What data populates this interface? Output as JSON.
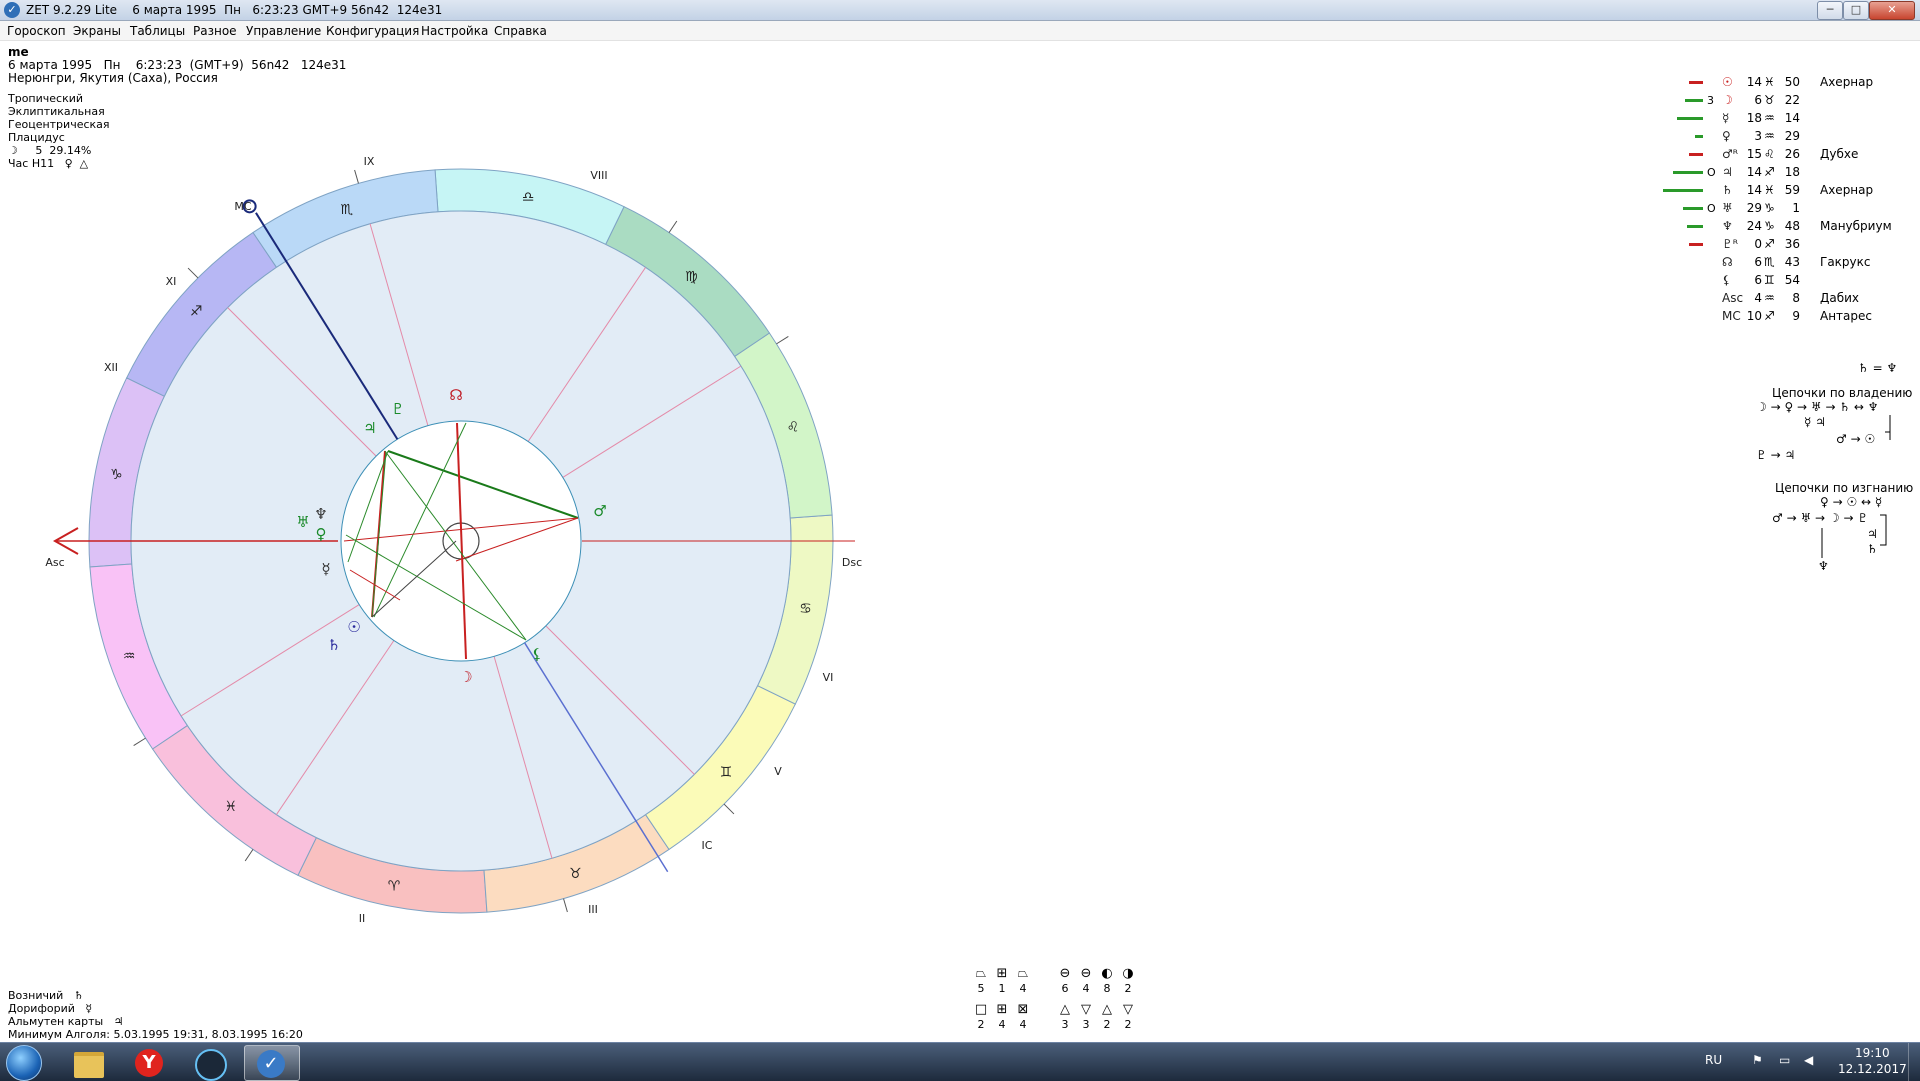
{
  "window": {
    "title": "ZET 9.2.29 Lite    6 марта 1995  Пн   6:23:23 GMT+9 56n42  124e31",
    "buttons": {
      "minimize": "─",
      "maximize": "□",
      "close": "✕"
    }
  },
  "menu": [
    "Гороскоп",
    "Экраны",
    "Таблицы",
    "Разное",
    "Управление",
    "Конфигурация",
    "Настройка",
    "Справка"
  ],
  "chart_info": {
    "name": "me",
    "date_line": "6 марта 1995   Пн    6:23:23  (GMT+9)  56n42   124e31",
    "place": "Нерюнгри, Якутия (Саха), Россия",
    "zodiac": "Тропический",
    "coord": "Эклиптикальная",
    "center": "Геоцентрическая",
    "houses": "Плацидус",
    "moon_phase": "☽     5  29.14%",
    "hour": "Час Н11   ♀  △"
  },
  "bottom_info": {
    "rising": "Возничий   ♄",
    "doryphory": "Дорифорий   ☿",
    "almuten": "Альмутен карты   ♃",
    "algol": "Минимум Алголя: 5.03.1995 19:31,  8.03.1995 16:20"
  },
  "wheel_labels": {
    "asc": "Asc",
    "dsc": "Dsc",
    "mc": "MC",
    "ic": "IC",
    "houses": {
      "II": "II",
      "III": "III",
      "V": "V",
      "VI": "VI",
      "VIII": "VIII",
      "IX": "IX",
      "XI": "XI",
      "XII": "XII"
    }
  },
  "signs": [
    "♈",
    "♉",
    "♊",
    "♋",
    "♌",
    "♍",
    "♎",
    "♏",
    "♐",
    "♑",
    "♒",
    "♓"
  ],
  "sign_colors": [
    "#f9c0c0",
    "#fcdcc0",
    "#fbfbb8",
    "#eef9c4",
    "#d2f5c8",
    "#aadcc2",
    "#c6f5f5",
    "#bad9f7",
    "#b7b7f4",
    "#dcc1f6",
    "#f9c2f6",
    "#f9c0dc"
  ],
  "chart_planets": [
    {
      "glyph": "☉",
      "color": "#2a2a9c"
    },
    {
      "glyph": "☽",
      "color": "#c0202a"
    },
    {
      "glyph": "☿",
      "color": "#333333"
    },
    {
      "glyph": "♀",
      "color": "#1a8a2a"
    },
    {
      "glyph": "♂",
      "color": "#1a8a2a"
    },
    {
      "glyph": "♃",
      "color": "#1a8a2a"
    },
    {
      "glyph": "♄",
      "color": "#2a2a9c"
    },
    {
      "glyph": "♅",
      "color": "#1a8a2a"
    },
    {
      "glyph": "♆",
      "color": "#333333"
    },
    {
      "glyph": "♇",
      "color": "#1a8a2a"
    },
    {
      "glyph": "☊",
      "color": "#c0202a"
    },
    {
      "glyph": "⚸",
      "color": "#1a8a2a"
    }
  ],
  "planet_table": [
    {
      "glyph": "☉",
      "deg": "14",
      "sign": "♓",
      "min": "50",
      "star": "Ахернар",
      "bars": [
        {
          "c": "#c82020",
          "w": 14
        },
        {
          "c": "#2a9a2a",
          "w": 0
        }
      ],
      "mark": ""
    },
    {
      "glyph": "☽",
      "deg": "6",
      "sign": "♉",
      "min": "22",
      "star": "",
      "bars": [
        {
          "c": "#2a9a2a",
          "w": 18
        }
      ],
      "mark": "3"
    },
    {
      "glyph": "☿",
      "deg": "18",
      "sign": "♒",
      "min": "14",
      "star": "",
      "bars": [
        {
          "c": "#2a9a2a",
          "w": 26
        }
      ],
      "mark": ""
    },
    {
      "glyph": "♀",
      "deg": "3",
      "sign": "♒",
      "min": "29",
      "star": "",
      "bars": [
        {
          "c": "#2a9a2a",
          "w": 8
        }
      ],
      "mark": ""
    },
    {
      "glyph": "♂ᴿ",
      "deg": "15",
      "sign": "♌",
      "min": "26",
      "star": "Дубхе",
      "bars": [
        {
          "c": "#c82020",
          "w": 14
        }
      ],
      "mark": ""
    },
    {
      "glyph": "♃",
      "deg": "14",
      "sign": "♐",
      "min": "18",
      "star": "",
      "bars": [
        {
          "c": "#2a9a2a",
          "w": 30
        }
      ],
      "mark": "O"
    },
    {
      "glyph": "♄",
      "deg": "14",
      "sign": "♓",
      "min": "59",
      "star": "Ахернар",
      "bars": [
        {
          "c": "#2a9a2a",
          "w": 40
        }
      ],
      "mark": ""
    },
    {
      "glyph": "♅",
      "deg": "29",
      "sign": "♑",
      "min": "1",
      "star": "",
      "bars": [
        {
          "c": "#2a9a2a",
          "w": 20
        }
      ],
      "mark": "O"
    },
    {
      "glyph": "♆",
      "deg": "24",
      "sign": "♑",
      "min": "48",
      "star": "Манубриум",
      "bars": [
        {
          "c": "#2a9a2a",
          "w": 16
        }
      ],
      "mark": ""
    },
    {
      "glyph": "♇ᴿ",
      "deg": "0",
      "sign": "♐",
      "min": "36",
      "star": "",
      "bars": [
        {
          "c": "#c82020",
          "w": 14
        }
      ],
      "mark": ""
    },
    {
      "glyph": "☊",
      "deg": "6",
      "sign": "♏",
      "min": "43",
      "star": "Гакрукс",
      "bars": [],
      "mark": ""
    },
    {
      "glyph": "⚸",
      "deg": "6",
      "sign": "♊",
      "min": "54",
      "star": "",
      "bars": [],
      "mark": ""
    },
    {
      "glyph": "Asc",
      "deg": "4",
      "sign": "♒",
      "min": "8",
      "star": "Дабих",
      "bars": [],
      "mark": ""
    },
    {
      "glyph": "MC",
      "deg": "10",
      "sign": "♐",
      "min": "9",
      "star": "Антарес",
      "bars": [],
      "mark": ""
    }
  ],
  "reception": {
    "saturn_neptune": "♄ = ♆",
    "rulership_title": "Цепочки по владению",
    "rulership_line1": "☽ → ♀ → ♅ → ♄ ↔ ♆",
    "rulership_line2": "☿ ♃",
    "rulership_line3": "♂ → ☉",
    "rulership_line4": "♇ → ♃",
    "exile_title": "Цепочки по изгнанию",
    "exile_line1": "♀ → ☉ ↔ ☿",
    "exile_line2": "♂ → ♅ → ☽ → ♇",
    "exile_line3": "♃",
    "exile_line4": "♄",
    "exile_line5": "♆"
  },
  "stats": {
    "row1_icons": [
      "⏢",
      "⊞",
      "⏢",
      "⊖",
      "⊖",
      "◐",
      "◑"
    ],
    "row1_values": [
      "5",
      "1",
      "4",
      "6",
      "4",
      "8",
      "2"
    ],
    "row2_icons": [
      "□",
      "⊞",
      "⊠",
      "△",
      "▽",
      "△",
      "▽"
    ],
    "row2_values": [
      "2",
      "4",
      "4",
      "3",
      "3",
      "2",
      "2"
    ]
  },
  "taskbar": {
    "lang": "RU",
    "time": "19:10",
    "date": "12.12.2017"
  }
}
